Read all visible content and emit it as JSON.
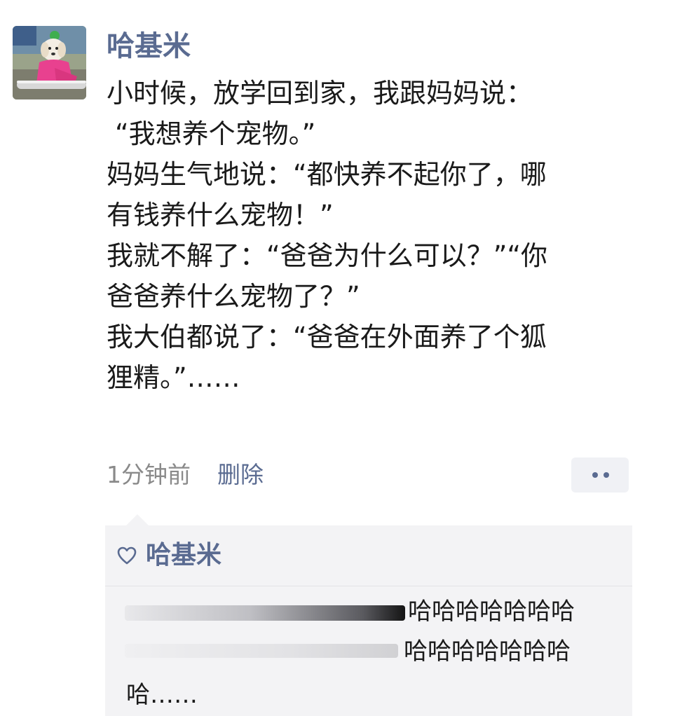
{
  "post": {
    "author": "哈基米",
    "avatar_icon": "avatar-dog-photo",
    "lines": [
      "小时候，放学回到家，我跟妈妈说：",
      "“我想养个宠物。”",
      "妈妈生气地说：“都快养不起你了，哪",
      "有钱养什么宠物！”",
      "我就不解了：“爸爸为什么可以？”“你",
      "爸爸养什么宠物了？”",
      "我大伯都说了：“爸爸在外面养了个狐",
      "狸精。”……"
    ],
    "time": "1分钟前",
    "delete_label": "删除",
    "more_icon": "more-dots-icon"
  },
  "interactions": {
    "like_icon": "heart-icon",
    "likes": "哈基米",
    "comment": {
      "line1": "哈哈哈哈哈哈哈",
      "line2": "哈哈哈哈哈哈哈",
      "line3": "哈……"
    }
  },
  "colors": {
    "name_link": "#5a6b91",
    "text": "#1a1a1a",
    "meta": "#8a8a8a",
    "panel_bg": "#f3f3f5"
  }
}
